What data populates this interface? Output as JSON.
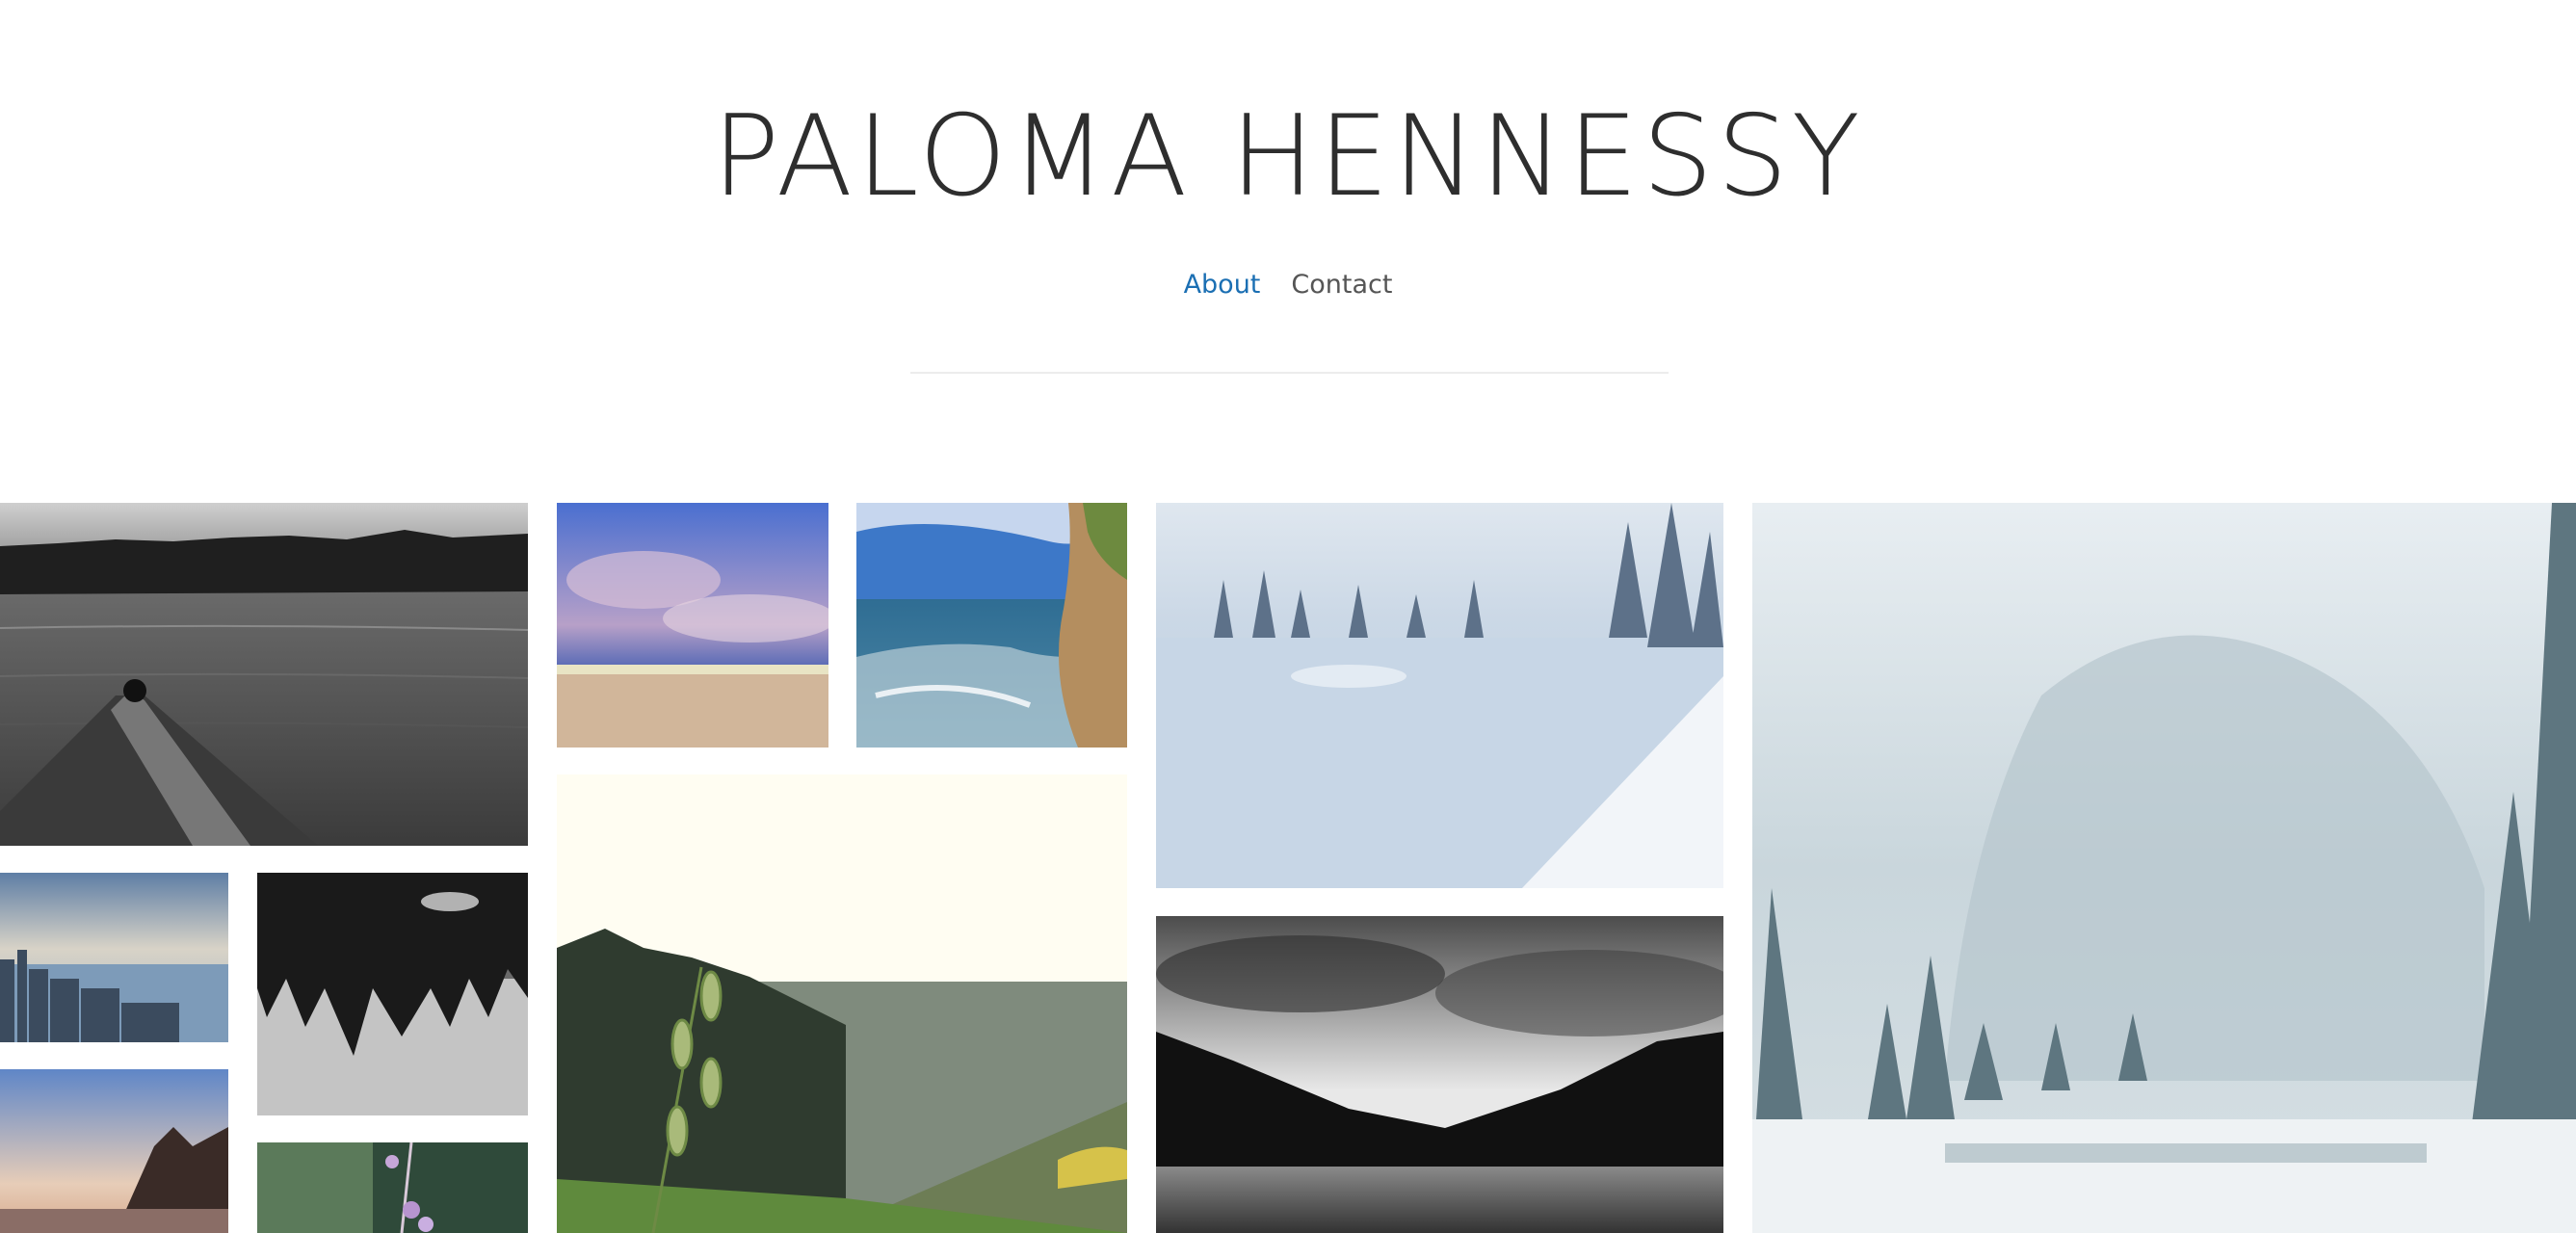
{
  "site": {
    "title": "PALOMA HENNESSY"
  },
  "nav": {
    "items": [
      {
        "label": "About"
      },
      {
        "label": "Contact"
      }
    ]
  },
  "gallery": {
    "photos": [
      {
        "subject": "kayak bow on black-and-white lake"
      },
      {
        "subject": "purple clouds over beach"
      },
      {
        "subject": "waves at sandstone cliff"
      },
      {
        "subject": "snowy frozen lake with pines"
      },
      {
        "subject": "snowfall over mountain lake"
      },
      {
        "subject": "city skyline by water"
      },
      {
        "subject": "inverted forest reflection"
      },
      {
        "subject": "grass stalk over forested valley"
      },
      {
        "subject": "black-and-white mountain lake with clouds"
      },
      {
        "subject": "sunset over river"
      },
      {
        "subject": "purple wildflower"
      }
    ]
  }
}
